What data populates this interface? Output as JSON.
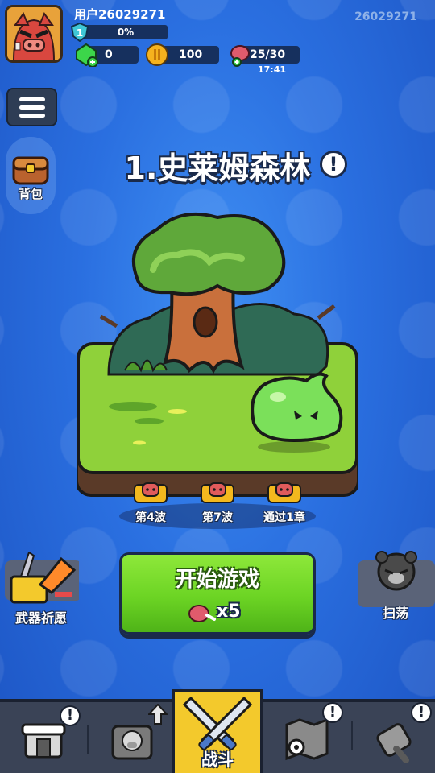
{
  "player": {
    "username": "用户26029271",
    "id": "26029271",
    "level": "1",
    "xp": "0%"
  },
  "resources": {
    "gems": "0",
    "coins": "100",
    "stamina": "25/30",
    "stamina_timer": "17:41"
  },
  "sidebar": {
    "backpack_label": "背包"
  },
  "stage": {
    "title": "1.史莱姆森林",
    "info_icon": "!"
  },
  "rewards": [
    {
      "label": "第4波"
    },
    {
      "label": "第7波"
    },
    {
      "label": "通过1章"
    }
  ],
  "actions": {
    "weapon_wish_label": "武器祈愿",
    "start_label": "开始游戏",
    "start_cost": "x5",
    "sweep_label": "扫荡"
  },
  "nav": {
    "battle_label": "战斗",
    "badge": "!"
  },
  "colors": {
    "accent_green": "#6cd424",
    "nav_active": "#f3c92c",
    "background": "#2a6fe0"
  }
}
